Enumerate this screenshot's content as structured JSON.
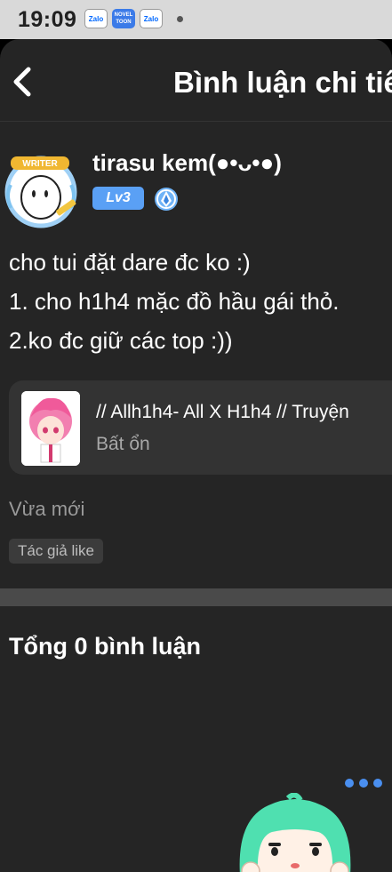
{
  "status_bar": {
    "time": "19:09",
    "icons": [
      {
        "name": "zalo-icon",
        "text": "Zalo"
      },
      {
        "name": "novel-toon-icon",
        "text": "NOVEL TOON"
      },
      {
        "name": "zalo-icon",
        "text": "Zalo"
      }
    ]
  },
  "header": {
    "title": "Bình luận chi tiết"
  },
  "comment": {
    "avatar_badge": "WRITER",
    "username": "tirasu kem(●•ᴗ•●)",
    "level": "Lv3",
    "lines": [
      "cho tui đặt dare đc ko :)",
      "1. cho h1h4 mặc đồ hầu gái thỏ.",
      "2.ko đc giữ các top :))"
    ],
    "book": {
      "title": "// Allh1h4- All X H1h4 // Truyện",
      "status": "Bất ổn"
    },
    "time_ago": "Vừa mới",
    "author_like": "Tác giả like"
  },
  "comments_section": {
    "total": "Tổng 0 bình luận"
  },
  "colors": {
    "background": "#252525",
    "card": "#333333",
    "level_badge": "#5aa0f5",
    "mascot_hair": "#4fe0b0"
  }
}
